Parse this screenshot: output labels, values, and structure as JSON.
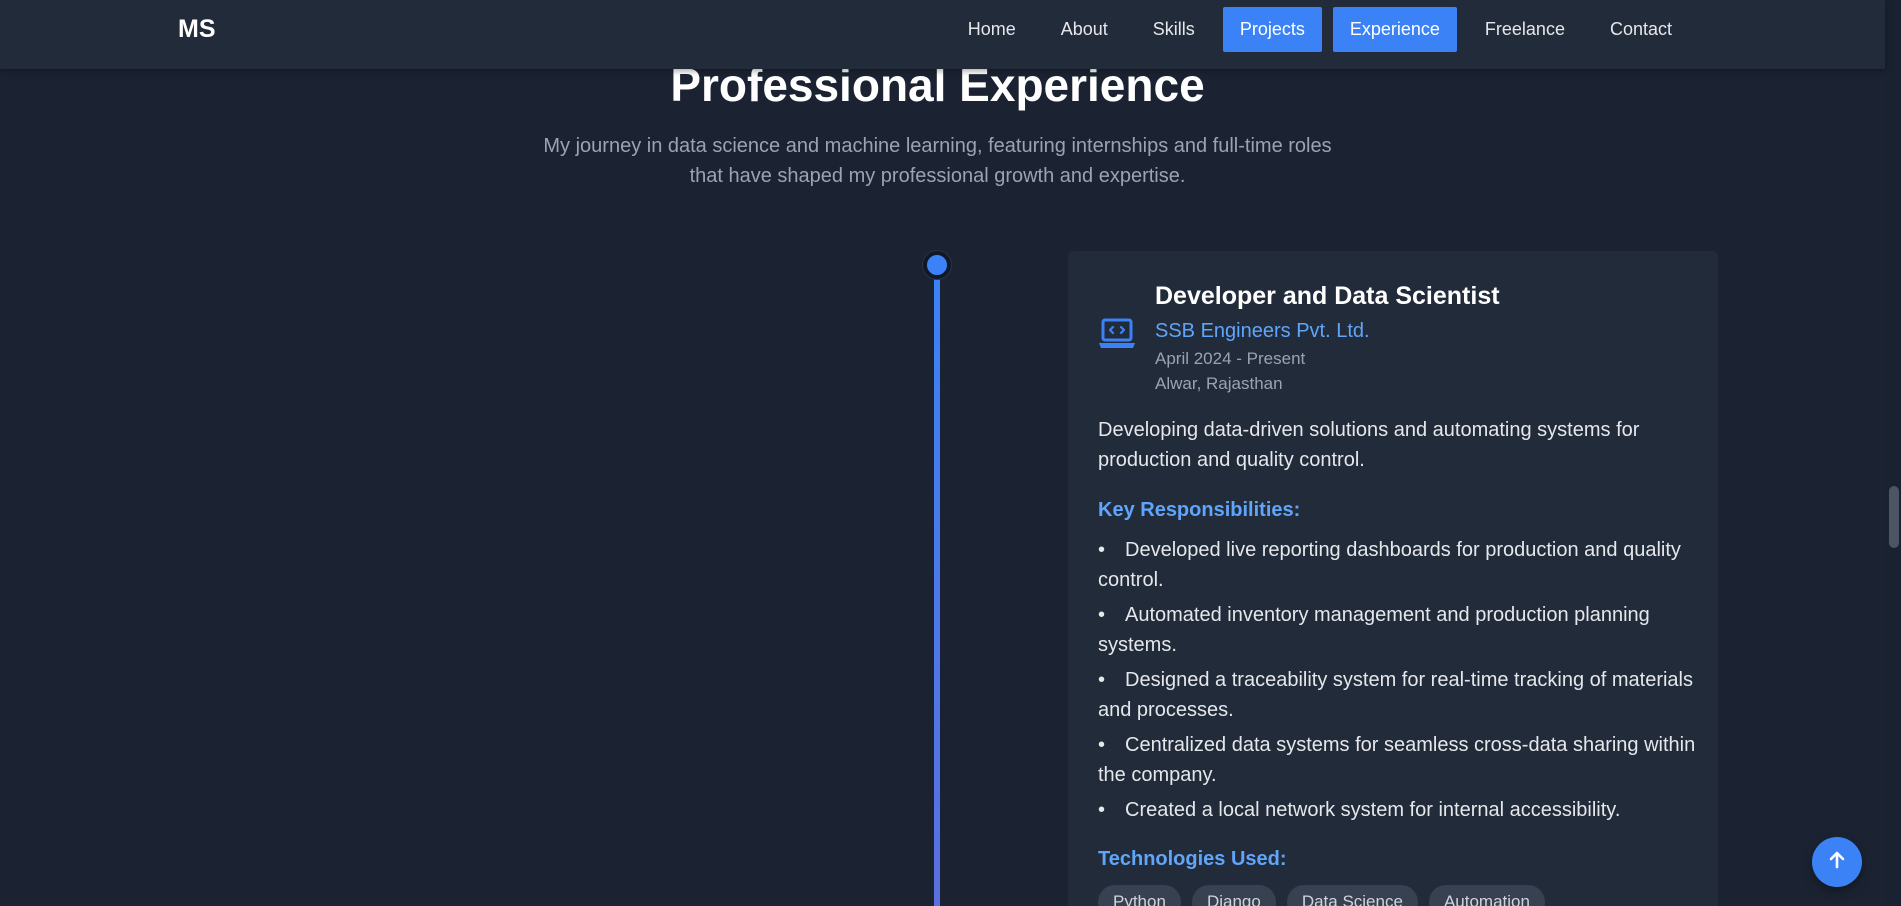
{
  "nav": {
    "logo": "MS",
    "links": [
      {
        "label": "Home",
        "active": false
      },
      {
        "label": "About",
        "active": false
      },
      {
        "label": "Skills",
        "active": false
      },
      {
        "label": "Projects",
        "active": true
      },
      {
        "label": "Experience",
        "active": true
      },
      {
        "label": "Freelance",
        "active": false
      },
      {
        "label": "Contact",
        "active": false
      }
    ]
  },
  "section": {
    "title": "Professional Experience",
    "subtitle": "My journey in data science and machine learning, featuring internships and full-time roles that have shaped my professional growth and expertise."
  },
  "experience": {
    "icon": "laptop-code-icon",
    "title": "Developer and Data Scientist",
    "company": "SSB Engineers Pvt. Ltd.",
    "period": "April 2024 - Present",
    "location": "Alwar, Rajasthan",
    "description": "Developing data-driven solutions and automating systems for production and quality control.",
    "responsibilities_heading": "Key Responsibilities:",
    "responsibilities": [
      "Developed live reporting dashboards for production and quality control.",
      "Automated inventory management and production planning systems.",
      "Designed a traceability system for real-time tracking of materials and processes.",
      "Centralized data systems for seamless cross-data sharing within the company.",
      "Created a local network system for internal accessibility."
    ],
    "technologies_heading": "Technologies Used:",
    "technologies": [
      "Python",
      "Django",
      "Data Science",
      "Automation"
    ]
  },
  "scroll_top": {
    "icon": "arrow-up-icon"
  },
  "colors": {
    "accent": "#3b82f6",
    "accent_text": "#60a5fa",
    "background": "#1b2332",
    "card": "#222b3a"
  }
}
